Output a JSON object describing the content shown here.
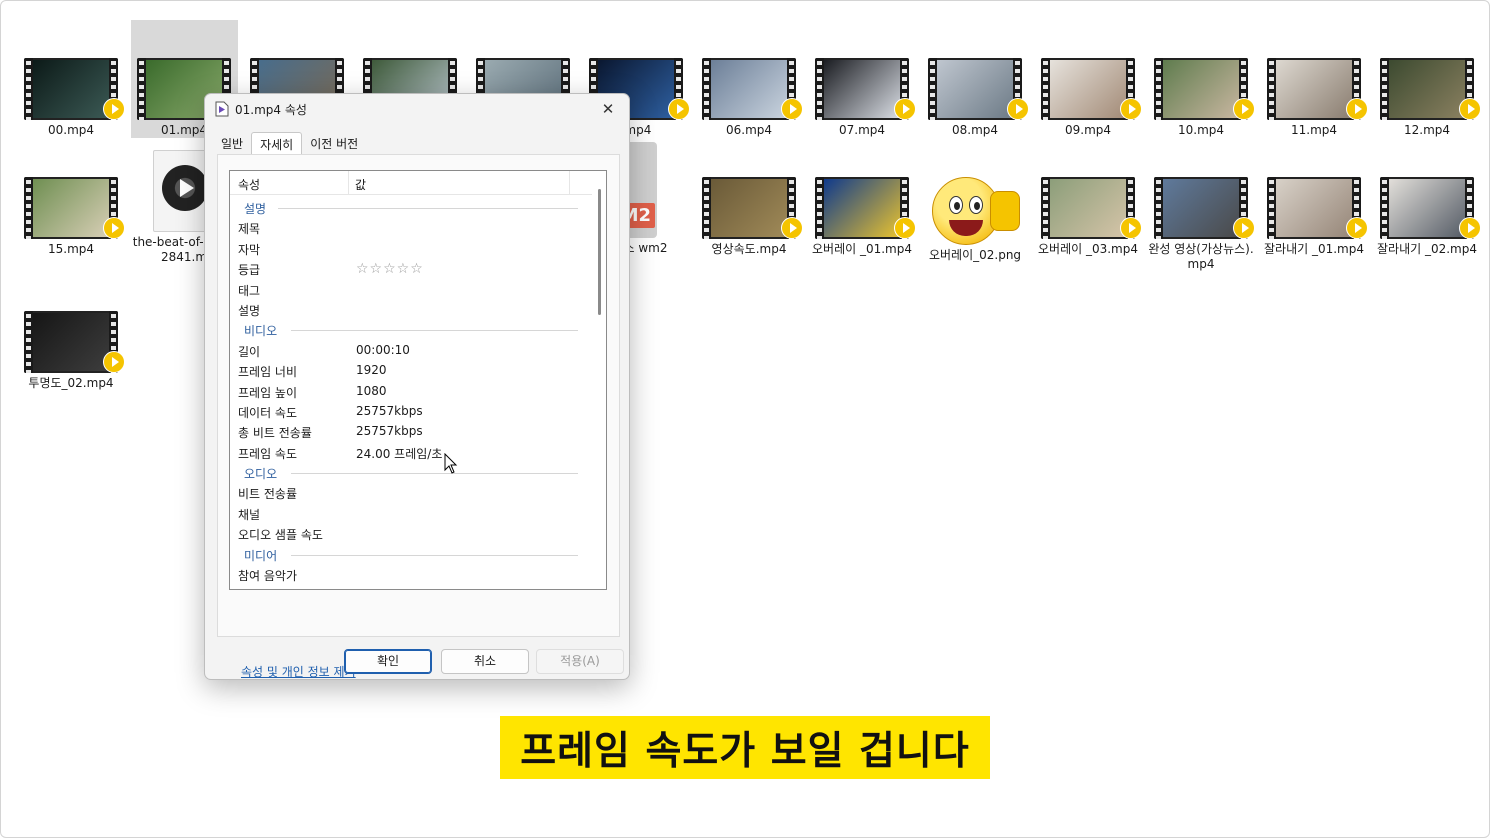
{
  "files": [
    {
      "label": "00.mp4",
      "kind": "video",
      "tone": [
        "#0c1a18",
        "#3b5954"
      ]
    },
    {
      "label": "01.mp4",
      "kind": "video",
      "tone": [
        "#3a6b2c",
        "#88a86a"
      ],
      "selected": true
    },
    {
      "label": "",
      "kind": "video",
      "tone": [
        "#486d8c",
        "#7a6a55"
      ]
    },
    {
      "label": "",
      "kind": "video",
      "tone": [
        "#3e5a3a",
        "#b8c4cc"
      ]
    },
    {
      "label": "",
      "kind": "video",
      "tone": [
        "#9aaab0",
        "#5c6e7a"
      ]
    },
    {
      "label": ".mp4",
      "kind": "video",
      "tone": [
        "#0a1730",
        "#2e5fa0"
      ]
    },
    {
      "label": "06.mp4",
      "kind": "video",
      "tone": [
        "#6c7f98",
        "#c9d3de"
      ]
    },
    {
      "label": "07.mp4",
      "kind": "video",
      "tone": [
        "#1b1d22",
        "#d9dde4"
      ]
    },
    {
      "label": "08.mp4",
      "kind": "video",
      "tone": [
        "#bfc6cf",
        "#6d7b87"
      ]
    },
    {
      "label": "09.mp4",
      "kind": "video",
      "tone": [
        "#e6e2dc",
        "#a38b77"
      ]
    },
    {
      "label": "10.mp4",
      "kind": "video",
      "tone": [
        "#5f7c4e",
        "#c8b6a0"
      ]
    },
    {
      "label": "11.mp4",
      "kind": "video",
      "tone": [
        "#ddd8d0",
        "#8a7d70"
      ]
    },
    {
      "label": "12.mp4",
      "kind": "video",
      "tone": [
        "#3c4a30",
        "#8a8060"
      ]
    },
    {
      "label": "15.mp4",
      "kind": "video",
      "tone": [
        "#6f8f52",
        "#d7ceb5"
      ]
    },
    {
      "label": "the-beat-of-re-122841.m",
      "kind": "audio"
    },
    {
      "label": "가상 뉴스 wm2",
      "kind": "wm"
    },
    {
      "label": "영상속도.mp4",
      "kind": "video",
      "tone": [
        "#6a5a38",
        "#a08a58"
      ]
    },
    {
      "label": "오버레이 _01.mp4",
      "kind": "video",
      "tone": [
        "#0f3a8c",
        "#e8c230"
      ]
    },
    {
      "label": "오버레이_02.png",
      "kind": "image"
    },
    {
      "label": "오버레이 _03.mp4",
      "kind": "video",
      "tone": [
        "#8c9e7a",
        "#d5c4a8"
      ]
    },
    {
      "label": "완성 영상(가상뉴스).mp4",
      "kind": "video",
      "tone": [
        "#5f7a9c",
        "#4a4a4a"
      ]
    },
    {
      "label": "잘라내기 _01.mp4",
      "kind": "video",
      "tone": [
        "#d8d1c8",
        "#968678"
      ]
    },
    {
      "label": "잘라내기 _02.mp4",
      "kind": "video",
      "tone": [
        "#e2dfda",
        "#555c66"
      ]
    },
    {
      "label": "투명도_02.mp4",
      "kind": "video",
      "tone": [
        "#161616",
        "#3d3d3d"
      ]
    }
  ],
  "dialog": {
    "title": "01.mp4 속성",
    "close_glyph": "✕",
    "tabs": [
      "일반",
      "자세히",
      "이전 버전"
    ],
    "active_tab": 1,
    "header": {
      "property": "속성",
      "value": "값"
    },
    "rows": [
      {
        "type": "group",
        "k": "설명"
      },
      {
        "type": "item",
        "k": "제목",
        "v": ""
      },
      {
        "type": "item",
        "k": "자막",
        "v": ""
      },
      {
        "type": "item",
        "k": "등급",
        "v": "☆☆☆☆☆",
        "stars": true
      },
      {
        "type": "item",
        "k": "태그",
        "v": ""
      },
      {
        "type": "item",
        "k": "설명",
        "v": ""
      },
      {
        "type": "group",
        "k": "비디오"
      },
      {
        "type": "item",
        "k": "길이",
        "v": "00:00:10"
      },
      {
        "type": "item",
        "k": "프레임 너비",
        "v": "1920"
      },
      {
        "type": "item",
        "k": "프레임 높이",
        "v": "1080"
      },
      {
        "type": "item",
        "k": "데이터 속도",
        "v": "25757kbps"
      },
      {
        "type": "item",
        "k": "총 비트 전송률",
        "v": "25757kbps"
      },
      {
        "type": "item",
        "k": "프레임 속도",
        "v": "24.00 프레임/초"
      },
      {
        "type": "group",
        "k": "오디오"
      },
      {
        "type": "item",
        "k": "비트 전송률",
        "v": ""
      },
      {
        "type": "item",
        "k": "채널",
        "v": ""
      },
      {
        "type": "item",
        "k": "오디오 샘플 속도",
        "v": ""
      },
      {
        "type": "group",
        "k": "미디어"
      },
      {
        "type": "item",
        "k": "참여 음악가",
        "v": ""
      }
    ],
    "remove_link": "속성 및 개인 정보 제거",
    "buttons": {
      "ok": "확인",
      "cancel": "취소",
      "apply": "적용(A)"
    }
  },
  "subtitle": "프레임 속도가 보일 겁니다",
  "colors": {
    "accent": "#1f5fae",
    "subtitle_bg": "#ffe500",
    "badge": "#f5c400"
  }
}
